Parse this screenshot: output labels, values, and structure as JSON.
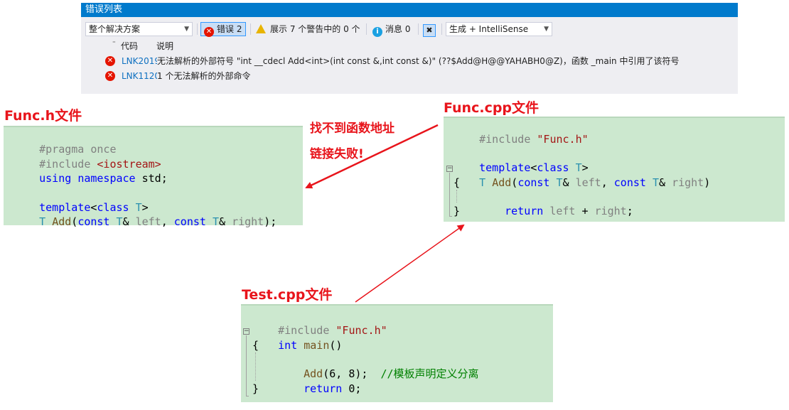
{
  "error_list": {
    "title": "错误列表",
    "scope_select": "整个解决方案",
    "errors_button": "错误 2",
    "warnings_button": "展示 7 个警告中的 0 个",
    "messages_button": "消息 0",
    "build_select": "生成 + IntelliSense",
    "columns": {
      "code": "代码",
      "description": "说明"
    },
    "rows": [
      {
        "code": "LNK2019",
        "description": "无法解析的外部符号 \"int __cdecl Add<int>(int const &,int const &)\" (??$Add@H@@YAHABH0@Z)，函数 _main 中引用了该符号"
      },
      {
        "code": "LNK1120",
        "description": "1 个无法解析的外部命令"
      }
    ]
  },
  "labels": {
    "func_h": "Func.h文件",
    "func_cpp": "Func.cpp文件",
    "test_cpp": "Test.cpp文件",
    "note_line1": "找不到函数地址",
    "note_line2": "链接失败!"
  },
  "func_h": {
    "l1": "#pragma once",
    "l2a": "#include ",
    "l2b": "<iostream>",
    "l3a": "using",
    "l3b": " ",
    "l3c": "namespace",
    "l3d": " std;",
    "l5a": "template",
    "l5b": "<",
    "l5c": "class",
    "l5d": " ",
    "l5e": "T",
    "l5f": ">",
    "l6a": "T",
    "l6b": " ",
    "l6c": "Add",
    "l6d": "(",
    "l6e": "const",
    "l6f": " ",
    "l6g": "T",
    "l6h": "& ",
    "l6i": "left",
    "l6j": ", ",
    "l6k": "const",
    "l6l": " ",
    "l6m": "T",
    "l6n": "& ",
    "l6o": "right",
    "l6p": ");"
  },
  "func_cpp": {
    "l1a": "#include ",
    "l1b": "\"Func.h\"",
    "l3a": "template",
    "l3b": "<",
    "l3c": "class",
    "l3d": " ",
    "l3e": "T",
    "l3f": ">",
    "l4a": "T",
    "l4b": " ",
    "l4c": "Add",
    "l4d": "(",
    "l4e": "const",
    "l4f": " ",
    "l4g": "T",
    "l4h": "& ",
    "l4i": "left",
    "l4j": ", ",
    "l4k": "const",
    "l4l": " ",
    "l4m": "T",
    "l4n": "& ",
    "l4o": "right",
    "l4p": ")",
    "l5": "{",
    "l6a": "return",
    "l6b": " ",
    "l6c": "left",
    "l6d": " + ",
    "l6e": "right",
    "l6f": ";",
    "l7": "}"
  },
  "test_cpp": {
    "l1a": "#include ",
    "l1b": "\"Func.h\"",
    "l2a": "int",
    "l2b": " ",
    "l2c": "main",
    "l2d": "()",
    "l3": "{",
    "l4a": "Add",
    "l4b": "(6, 8);",
    "l4c": "  ",
    "l4d": "//模板声明定义分离",
    "l5a": "return",
    "l5b": " 0;",
    "l6": "}"
  },
  "colors": {
    "label_red": "#e8141b",
    "code_bg": "#cce8cf",
    "title_blue": "#007acc"
  }
}
